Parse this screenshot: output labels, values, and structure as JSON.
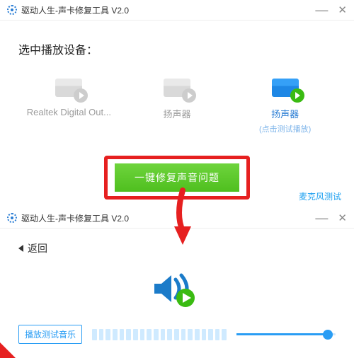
{
  "app_title": "驱动人生-声卡修复工具 V2.0",
  "window1": {
    "section_title": "选中播放设备：",
    "devices": [
      {
        "label": "Realtek Digital Out...",
        "active": false
      },
      {
        "label": "扬声器",
        "active": false
      },
      {
        "label": "扬声器",
        "sub": "(点击测试播放)",
        "active": true
      }
    ],
    "fix_button": "一键修复声音问题",
    "mic_test_link": "麦克风测试"
  },
  "window2": {
    "back_label": "返回",
    "play_music_button": "播放测试音乐",
    "volume_percent": 92
  }
}
